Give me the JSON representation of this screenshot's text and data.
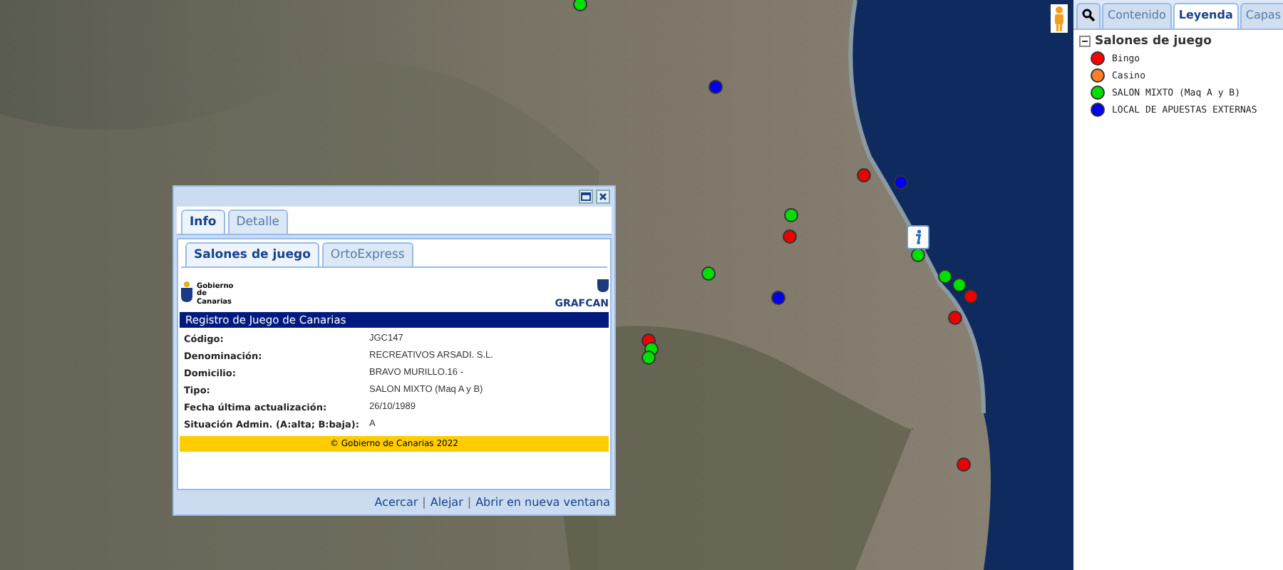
{
  "map": {
    "markers": [
      {
        "color": "#00e000"
      },
      {
        "color": "#0000ee"
      },
      {
        "color": "#ee0000"
      },
      {
        "color": "#0000ee"
      },
      {
        "color": "#00e000"
      },
      {
        "color": "#ee0000"
      },
      {
        "color": "#00e000"
      },
      {
        "color": "#0000ee"
      },
      {
        "color": "#00e000"
      },
      {
        "color": "#00e000"
      },
      {
        "color": "#ee0000"
      },
      {
        "color": "#00e000"
      },
      {
        "color": "#ee0000"
      },
      {
        "color": "#ee0000"
      },
      {
        "color": "#ee0000"
      },
      {
        "color": "#00e000"
      },
      {
        "color": "#00e000"
      }
    ]
  },
  "info_window": {
    "tabs": [
      {
        "label": "Info",
        "selected": true
      },
      {
        "label": "Detalle",
        "selected": false
      }
    ],
    "subtabs": [
      {
        "label": "Salones de juego",
        "selected": true
      },
      {
        "label": "OrtoExpress",
        "selected": false
      }
    ],
    "logo_left": "Gobierno de Canarias",
    "logo_right": "GRAFCAN",
    "header": "Registro de Juego de Canarias",
    "fields": [
      {
        "label": "Código:",
        "value": "JGC147"
      },
      {
        "label": "Denominación:",
        "value": "RECREATIVOS ARSADI. S.L."
      },
      {
        "label": "Domicilio:",
        "value": "BRAVO MURILLO.16 -"
      },
      {
        "label": "Tipo:",
        "value": "SALON MIXTO (Maq A y B)"
      },
      {
        "label": "Fecha última actualización:",
        "value": "26/10/1989"
      },
      {
        "label": "Situación Admin. (A:alta; B:baja):",
        "value": "A"
      }
    ],
    "footer": "© Gobierno de Canarias 2022",
    "links": [
      "Acercar",
      "Alejar",
      "Abrir en nueva ventana"
    ],
    "separator": "|"
  },
  "side_panel": {
    "tabs": [
      {
        "kind": "search",
        "selected": false
      },
      {
        "kind": "text",
        "label": "Contenido",
        "selected": false
      },
      {
        "kind": "text",
        "label": "Leyenda",
        "selected": true
      },
      {
        "kind": "text",
        "label": "Capas",
        "selected": false
      }
    ],
    "legend": {
      "title": "Salones de juego",
      "expanded": true,
      "items": [
        {
          "label": "Bingo",
          "color": "#ff0000"
        },
        {
          "label": "Casino",
          "color": "#ff7f27"
        },
        {
          "label": "SALON MIXTO (Maq A y B)",
          "color": "#00e000"
        },
        {
          "label": "LOCAL DE APUESTAS EXTERNAS",
          "color": "#0000ee"
        }
      ]
    }
  }
}
